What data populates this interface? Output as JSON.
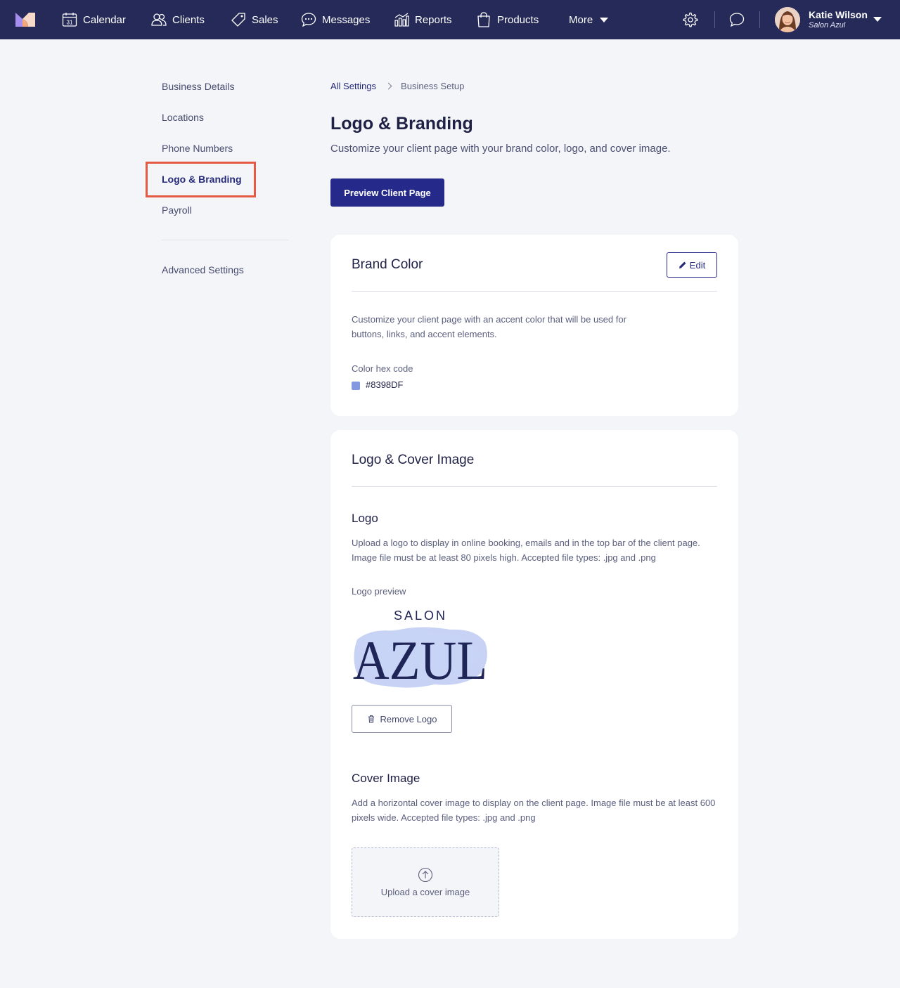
{
  "nav": {
    "items": [
      {
        "label": "Calendar",
        "icon": "calendar-icon"
      },
      {
        "label": "Clients",
        "icon": "clients-icon"
      },
      {
        "label": "Sales",
        "icon": "tag-icon"
      },
      {
        "label": "Messages",
        "icon": "chat-bubble-icon"
      },
      {
        "label": "Reports",
        "icon": "bar-chart-icon"
      },
      {
        "label": "Products",
        "icon": "shopping-bag-icon"
      }
    ],
    "more_label": "More",
    "calendar_day": "31",
    "user": {
      "name": "Katie Wilson",
      "business": "Salon Azul"
    }
  },
  "sidebar": {
    "items": [
      {
        "label": "Business Details"
      },
      {
        "label": "Locations"
      },
      {
        "label": "Phone Numbers"
      },
      {
        "label": "Logo & Branding",
        "active": true
      },
      {
        "label": "Payroll"
      }
    ],
    "advanced_label": "Advanced Settings"
  },
  "breadcrumb": {
    "root": "All Settings",
    "current": "Business Setup"
  },
  "page": {
    "title": "Logo & Branding",
    "subtitle": "Customize your client page with your brand color, logo, and cover image.",
    "preview_button": "Preview Client Page"
  },
  "brand_color": {
    "title": "Brand Color",
    "edit_label": "Edit",
    "description": "Customize your client page with an accent color that will be used for buttons, links, and accent elements.",
    "hex_label": "Color hex code",
    "hex_value": "#8398DF"
  },
  "logo_cover": {
    "title": "Logo & Cover Image",
    "logo_heading": "Logo",
    "logo_description": "Upload a logo to display in online booking, emails and in the top bar of the client page. Image file must be at least 80 pixels high. Accepted file types: .jpg and .png",
    "preview_label": "Logo preview",
    "logo_small_text": "SALON",
    "logo_big_text": "AZUL",
    "remove_label": "Remove Logo",
    "cover_heading": "Cover Image",
    "cover_description": "Add a horizontal cover image to display on the client page. Image file must be at least 600 pixels wide. Accepted file types: .jpg and .png",
    "upload_label": "Upload a cover image"
  },
  "colors": {
    "nav_bg": "#252A59",
    "primary": "#252A8A",
    "highlight_box": "#E45A43",
    "brand_swatch": "#8398DF"
  }
}
